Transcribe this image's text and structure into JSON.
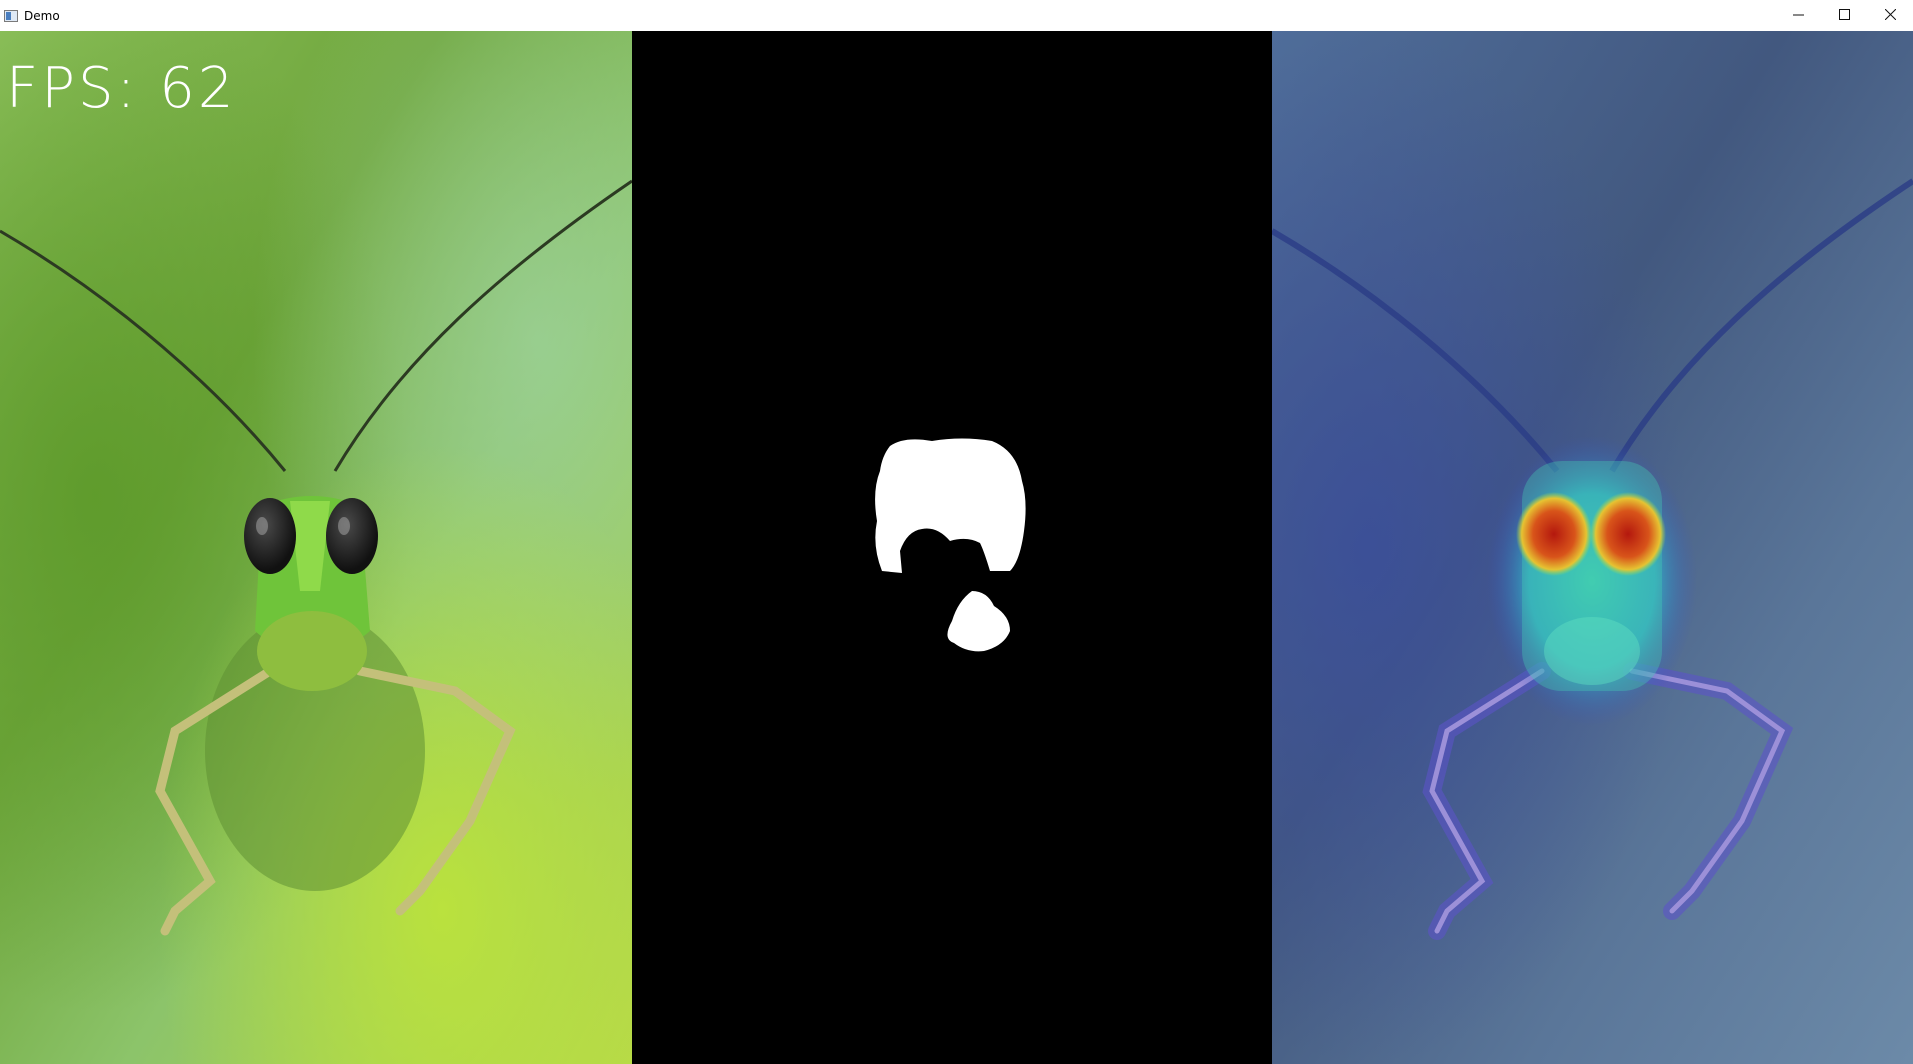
{
  "window": {
    "title": "Demo",
    "controls": {
      "minimize": "—",
      "maximize": "☐",
      "close": "✕"
    }
  },
  "overlay": {
    "fps_label": "FPS:",
    "fps_value": "62"
  },
  "icons": {
    "app": "window-app-icon",
    "minimize": "minimize-icon",
    "maximize": "maximize-icon",
    "close": "close-icon"
  },
  "colors": {
    "titlebar": "#ffffff",
    "mask_background": "#000000",
    "mask_foreground": "#ffffff",
    "photo_green": "#7fb64a",
    "heatmap_blue": "#3b5aa8",
    "heatmap_red": "#c8281a"
  }
}
